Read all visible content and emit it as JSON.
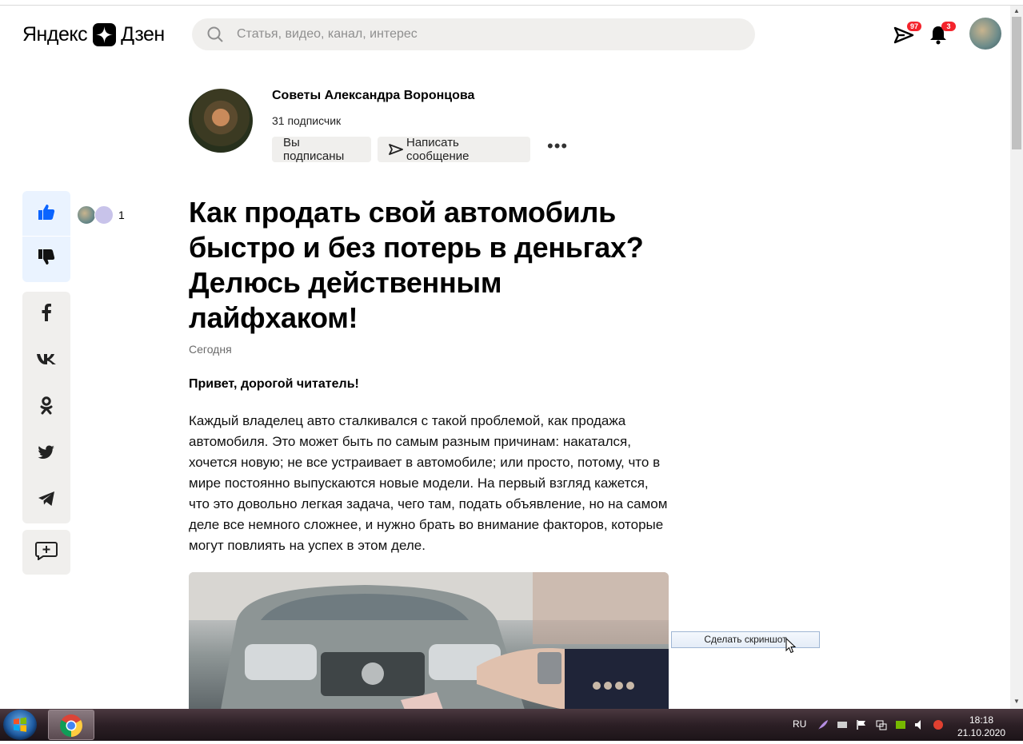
{
  "header": {
    "logo_left": "Яндекс",
    "logo_right": "Дзен",
    "search_placeholder": "Статья, видео, канал, интерес",
    "messages_badge": "97",
    "notifications_badge": "3"
  },
  "channel": {
    "name": "Советы Александра Воронцова",
    "subscribers": "31 подписчик",
    "subscribed_label": "Вы подписаны",
    "message_label": "Написать сообщение",
    "more_label": "•••"
  },
  "reactions": {
    "likes_count": "1"
  },
  "article": {
    "title": "Как продать свой автомобиль быстро и без потерь в деньгах? Делюсь действенным лайфхаком!",
    "date": "Сегодня",
    "lead": "Привет, дорогой читатель!",
    "paragraph": "Каждый владелец авто сталкивался с такой проблемой, как продажа автомобиля. Это может быть по самым разным причинам: накатался, хочется новую; не все устраивает в автомобиле; или просто, потому, что в мире постоянно выпускаются новые модели. На первый взгляд кажется, что это довольно легкая задача, чего там, подать объявление, но на самом деле все немного сложнее, и нужно брать во внимание факторов, которые могут повлиять на успех в этом деле."
  },
  "tooltip": {
    "label": "Сделать скриншот"
  },
  "taskbar": {
    "language": "RU",
    "time": "18:18",
    "date": "21.10.2020"
  },
  "colors": {
    "accent_blue": "#0a64ff",
    "badge_red": "#f4242c",
    "button_bg": "#f0efed",
    "like_rail_bg": "#eaf3ff"
  },
  "icons": [
    "search-icon",
    "send-icon",
    "bell-icon",
    "thumbs-up-icon",
    "thumbs-down-icon",
    "facebook-icon",
    "vk-icon",
    "odnoklassniki-icon",
    "twitter-icon",
    "telegram-icon",
    "add-to-collection-icon",
    "windows-start-icon",
    "chrome-icon"
  ]
}
